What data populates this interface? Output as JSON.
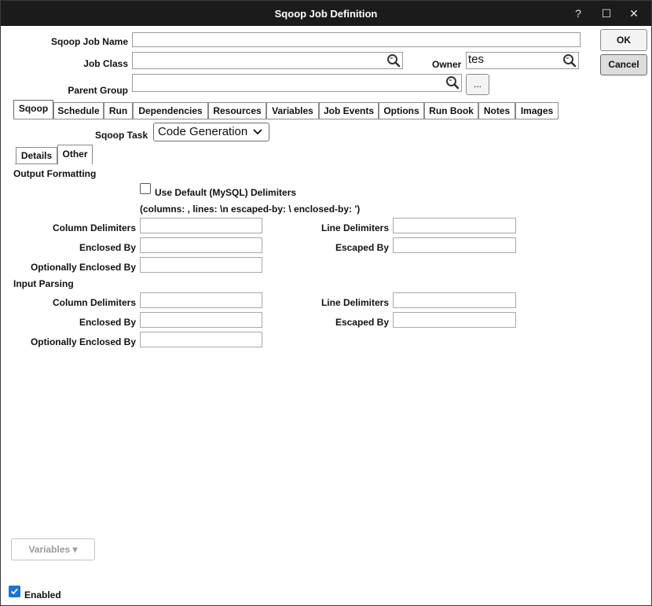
{
  "window": {
    "title": "Sqoop Job Definition",
    "help_label": "?",
    "maximize_label": "☐",
    "close_label": "✕"
  },
  "form": {
    "job_name_label": "Sqoop Job Name",
    "job_name_value": "",
    "job_class_label": "Job Class",
    "job_class_value": "",
    "owner_label": "Owner",
    "owner_value": "tes",
    "parent_group_label": "Parent Group",
    "parent_group_value": "",
    "ellipsis_label": "..."
  },
  "actions": {
    "ok_label": "OK",
    "cancel_label": "Cancel"
  },
  "tabs": [
    {
      "label": "Sqoop",
      "active": true
    },
    {
      "label": "Schedule"
    },
    {
      "label": "Run"
    },
    {
      "label": "Dependencies"
    },
    {
      "label": "Resources"
    },
    {
      "label": "Variables"
    },
    {
      "label": "Job Events"
    },
    {
      "label": "Options"
    },
    {
      "label": "Run Book"
    },
    {
      "label": "Notes"
    },
    {
      "label": "Images"
    }
  ],
  "sqoop": {
    "task_label": "Sqoop Task",
    "task_value": "Code Generation",
    "subtabs": [
      {
        "label": "Details"
      },
      {
        "label": "Other",
        "active": true
      }
    ]
  },
  "output_formatting": {
    "heading": "Output Formatting",
    "use_default_label": "Use Default (MySQL) Delimiters",
    "use_default_checked": false,
    "defaults_note": "(columns: , lines: \\n escaped-by: \\ enclosed-by: ')",
    "column_delimiters_label": "Column Delimiters",
    "line_delimiters_label": "Line Delimiters",
    "enclosed_by_label": "Enclosed By",
    "escaped_by_label": "Escaped By",
    "optionally_enclosed_by_label": "Optionally Enclosed By"
  },
  "input_parsing": {
    "heading": "Input Parsing",
    "column_delimiters_label": "Column Delimiters",
    "line_delimiters_label": "Line Delimiters",
    "enclosed_by_label": "Enclosed By",
    "escaped_by_label": "Escaped By",
    "optionally_enclosed_by_label": "Optionally Enclosed By"
  },
  "footer": {
    "variables_button_label": "Variables ▾",
    "enabled_label": "Enabled",
    "enabled_checked": true
  },
  "colors": {
    "titlebar": "#1b1b1b",
    "checkbox_accent": "#1976d2"
  },
  "icons": [
    "magnifier-icon",
    "chevron-down-icon",
    "check-icon"
  ]
}
